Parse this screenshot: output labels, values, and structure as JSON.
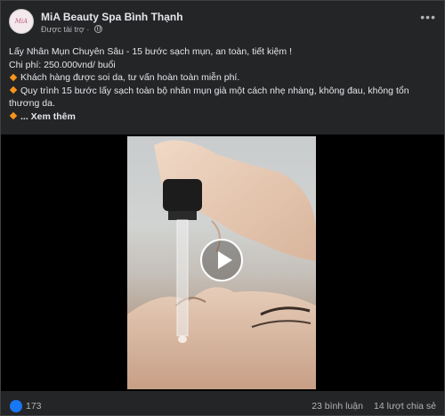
{
  "post": {
    "page_name": "MiA Beauty Spa Bình Thạnh",
    "sponsored_label": "Được tài trợ",
    "avatar_text": "MiA",
    "lines": [
      "Lấy Nhân Mụn Chuyên Sâu - 15 bước sạch mụn, an toàn, tiết kiệm !",
      "Chi phí: 250.000vnd/ buổi",
      "Khách hàng được soi da, tư vấn hoàn toàn miễn phí.",
      "Quy trình 15 bước lấy sạch toàn bộ nhân mụn già một cách nhẹ nhàng, không đau, không tổn thương da."
    ],
    "see_more": "... Xem thêm"
  },
  "stats": {
    "likes": "173",
    "comments": "23 bình luận",
    "shares": "14 lượt chia sẻ"
  },
  "icons": {
    "more": "more-options-icon",
    "globe": "globe-icon",
    "bullet": "orange-diamond-icon",
    "play": "play-icon",
    "like": "like-reaction-icon"
  },
  "colors": {
    "accent": "#1877f2",
    "bullet": "#f7941d",
    "background": "#242526"
  }
}
